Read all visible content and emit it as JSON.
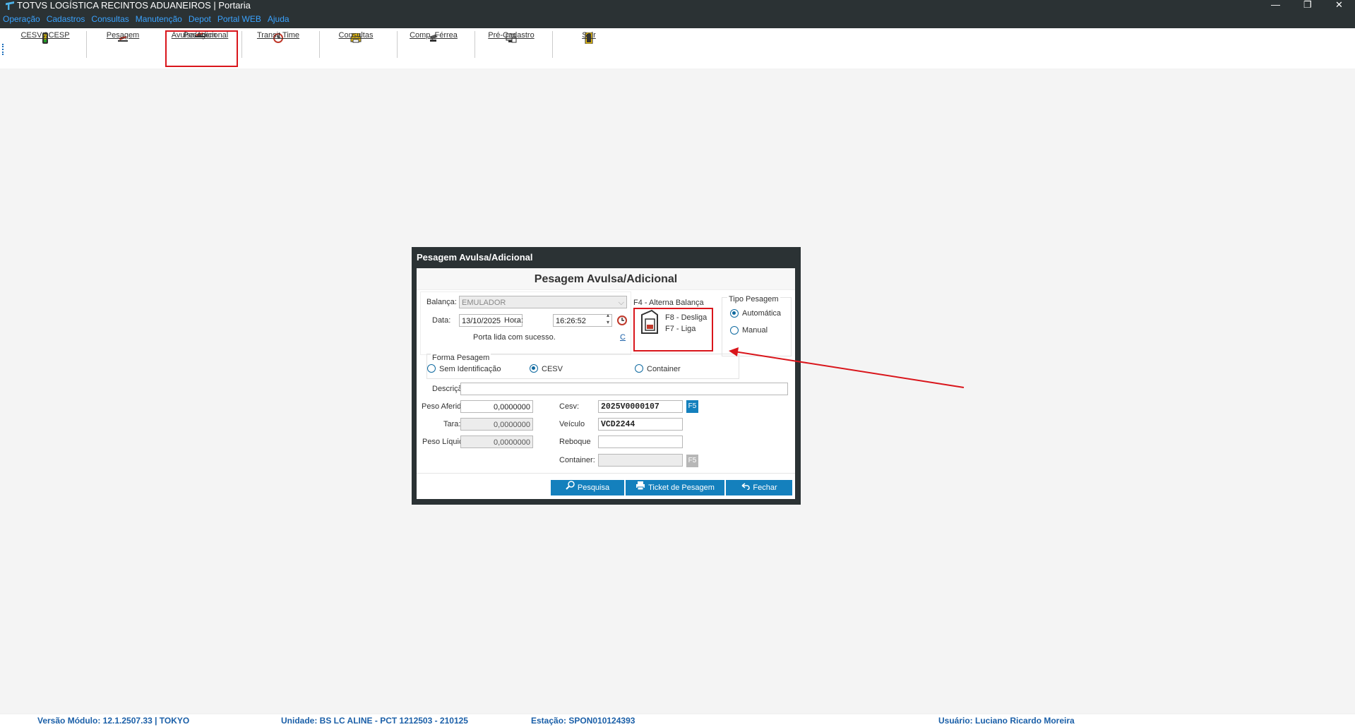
{
  "window": {
    "title": "TOTVS LOGÍSTICA RECINTOS ADUANEIROS | Portaria"
  },
  "menu": [
    "Operação",
    "Cadastros",
    "Consultas",
    "Manutenção",
    "Depot",
    "Portal WEB",
    "Ajuda"
  ],
  "window_controls": {
    "minimize": "—",
    "restore": "❐",
    "close": "✕"
  },
  "toolbar": {
    "cesv": "CESV / CESP",
    "pesagem": "Pesagem",
    "pesagem_avulsa_1": "Pesagem",
    "pesagem_avulsa_2": "Avulsa/Adicional",
    "transit": "Transit Time",
    "consultas": "Consultas",
    "comp_ferrea": "Comp. Férrea",
    "pre_cadastro": "Pré-Cadastro",
    "sair": "Sair"
  },
  "dialog": {
    "window_title": "Pesagem Avulsa/Adicional",
    "heading": "Pesagem Avulsa/Adicional",
    "balanca_label": "Balança:",
    "balanca_value": "EMULADOR",
    "data_label": "Data:",
    "data_value": "13/10/2025",
    "hora_label": "Hora:",
    "hora_value": "16:26:52",
    "status_msg": "Porta lida com sucesso.",
    "c_link": "C",
    "f4_label": "F4 - Alterna Balança",
    "f8_label": "F8 - Desliga",
    "f7_label": "F7 - Liga",
    "tipo_pesagem": {
      "title": "Tipo Pesagem",
      "automatica": "Automática",
      "manual": "Manual",
      "selected": "Automática"
    },
    "forma_pesagem": {
      "title": "Forma Pesagem",
      "sem_id": "Sem Identificação",
      "cesv": "CESV",
      "container": "Container",
      "selected": "CESV"
    },
    "descricao_label": "Descrição:",
    "descricao_value": "",
    "peso_aferido_label": "Peso Aferido:",
    "peso_aferido_value": "0,0000000",
    "tara_label": "Tara:",
    "tara_value": "0,0000000",
    "peso_liquido_label": "Peso Líquido:",
    "peso_liquido_value": "0,0000000",
    "cesv_label": "Cesv:",
    "cesv_value": "2025V0000107",
    "veiculo_label": "Veículo",
    "veiculo_value": "VCD2244",
    "reboque_label": "Reboque",
    "reboque_value": "",
    "container_label": "Container:",
    "container_value": "",
    "f5": "F5",
    "btn_pesquisa": "Pesquisa",
    "btn_ticket": "Ticket de Pesagem",
    "btn_fechar": "Fechar"
  },
  "status": {
    "versao": "Versão Módulo:  12.1.2507.33  |  TOKYO",
    "unidade": "Unidade: BS LC ALINE - PCT 1212503 - 210125",
    "estacao": "Estação: SPON010124393",
    "usuario": "Usuário: Luciano Ricardo Moreira"
  },
  "colors": {
    "accent": "#1480bd",
    "titlebar": "#2b3234",
    "highlight": "#d9151b",
    "menu": "#3aa3ff"
  }
}
